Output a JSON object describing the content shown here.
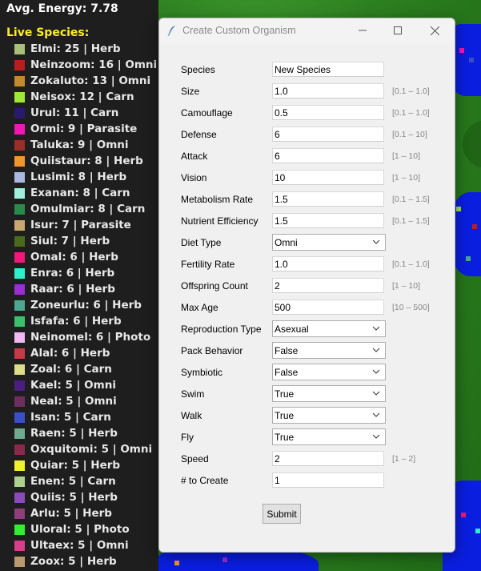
{
  "sidebar": {
    "avg_energy": "Avg. Energy: 7.78",
    "live_title": "Live Species:",
    "species": [
      {
        "label": "Elmi: 25 | Herb",
        "color": "#a9c07a"
      },
      {
        "label": "Neinzoom: 16 | Omni",
        "color": "#b81e1e"
      },
      {
        "label": "Zokaluto: 13 | Omni",
        "color": "#c08a2e"
      },
      {
        "label": "Neisox: 12 | Carn",
        "color": "#9ee63a"
      },
      {
        "label": "Urul: 11 | Carn",
        "color": "#2a1a6e"
      },
      {
        "label": "Ormi: 9 | Parasite",
        "color": "#f018b4"
      },
      {
        "label": "Taluka: 9 | Omni",
        "color": "#9a2e28"
      },
      {
        "label": "Quiistaur: 8 | Herb",
        "color": "#f0962e"
      },
      {
        "label": "Lusimi: 8 | Herb",
        "color": "#aab8e0"
      },
      {
        "label": "Exanan: 8 | Carn",
        "color": "#9ef0dc"
      },
      {
        "label": "Omulmiar: 8 | Carn",
        "color": "#2a8a4a"
      },
      {
        "label": "Isur: 7 | Parasite",
        "color": "#c8a86e"
      },
      {
        "label": "Siul: 7 | Herb",
        "color": "#4a6a1e"
      },
      {
        "label": "Omal: 6 | Herb",
        "color": "#f01878"
      },
      {
        "label": "Enra: 6 | Herb",
        "color": "#2ef0c8"
      },
      {
        "label": "Raar: 6 | Herb",
        "color": "#9a2ed0"
      },
      {
        "label": "Zoneurlu: 6 | Herb",
        "color": "#4aa88e"
      },
      {
        "label": "Isfafa: 6 | Herb",
        "color": "#3ac06a"
      },
      {
        "label": "Neinomel: 6 | Photo",
        "color": "#f0b8f0"
      },
      {
        "label": "Alal: 6 | Herb",
        "color": "#c83a4a"
      },
      {
        "label": "Zoal: 6 | Carn",
        "color": "#dcdc8a"
      },
      {
        "label": "Kael: 5 | Omni",
        "color": "#4a1e7e"
      },
      {
        "label": "Neal: 5 | Omni",
        "color": "#6e2e5e"
      },
      {
        "label": "Isan: 5 | Carn",
        "color": "#3a4ec8"
      },
      {
        "label": "Raen: 5 | Herb",
        "color": "#6eaa8e"
      },
      {
        "label": "Oxquitomi: 5 | Omni",
        "color": "#8a2a4a"
      },
      {
        "label": "Quiar: 5 | Herb",
        "color": "#f0f02e"
      },
      {
        "label": "Enen: 5 | Carn",
        "color": "#aed08e"
      },
      {
        "label": "Quiis: 5 | Herb",
        "color": "#8a4ab8"
      },
      {
        "label": "Arlu: 5 | Herb",
        "color": "#8e3e7a"
      },
      {
        "label": "Uloral: 5 | Photo",
        "color": "#2ef02e"
      },
      {
        "label": "Ultaex: 5 | Omni",
        "color": "#d83e8a"
      },
      {
        "label": "Zoox: 5 | Herb",
        "color": "#b89a6e"
      }
    ]
  },
  "dialog": {
    "title": "Create Custom Organism",
    "fields": [
      {
        "label": "Species",
        "type": "input",
        "value": "New Species",
        "range": ""
      },
      {
        "label": "Size",
        "type": "input",
        "value": "1.0",
        "range": "[0.1 – 1.0]"
      },
      {
        "label": "Camouflage",
        "type": "input",
        "value": "0.5",
        "range": "[0.1 – 1.0]"
      },
      {
        "label": "Defense",
        "type": "input",
        "value": "6",
        "range": "[0.1 – 10]"
      },
      {
        "label": "Attack",
        "type": "input",
        "value": "6",
        "range": "[1 – 10]"
      },
      {
        "label": "Vision",
        "type": "input",
        "value": "10",
        "range": "[1 – 10]"
      },
      {
        "label": "Metabolism Rate",
        "type": "input",
        "value": "1.5",
        "range": "[0.1 – 1.5]"
      },
      {
        "label": "Nutrient Efficiency",
        "type": "input",
        "value": "1.5",
        "range": "[0.1 – 1.5]"
      },
      {
        "label": "Diet Type",
        "type": "select",
        "value": "Omni",
        "range": ""
      },
      {
        "label": "Fertility Rate",
        "type": "input",
        "value": "1.0",
        "range": "[0.1 – 1.0]"
      },
      {
        "label": "Offspring Count",
        "type": "input",
        "value": "2",
        "range": "[1 – 10]"
      },
      {
        "label": "Max Age",
        "type": "input",
        "value": "500",
        "range": "[10 – 500]"
      },
      {
        "label": "Reproduction Type",
        "type": "select",
        "value": "Asexual",
        "range": ""
      },
      {
        "label": "Pack Behavior",
        "type": "select",
        "value": "False",
        "range": ""
      },
      {
        "label": "Symbiotic",
        "type": "select",
        "value": "False",
        "range": ""
      },
      {
        "label": "Swim",
        "type": "select",
        "value": "True",
        "range": ""
      },
      {
        "label": "Walk",
        "type": "select",
        "value": "True",
        "range": ""
      },
      {
        "label": "Fly",
        "type": "select",
        "value": "True",
        "range": ""
      },
      {
        "label": "Speed",
        "type": "input",
        "value": "2",
        "range": "[1 – 2]"
      },
      {
        "label": "# to Create",
        "type": "input",
        "value": "1",
        "range": ""
      }
    ],
    "submit_label": "Submit",
    "window_controls": {
      "minimize": "minimize-icon",
      "maximize": "maximize-icon",
      "close": "close-icon"
    }
  },
  "colors": {
    "panel_bg": "#1e1e1e",
    "title_yellow": "#ffee22",
    "water": "#0a1ee0",
    "grass": "#2d8020"
  }
}
